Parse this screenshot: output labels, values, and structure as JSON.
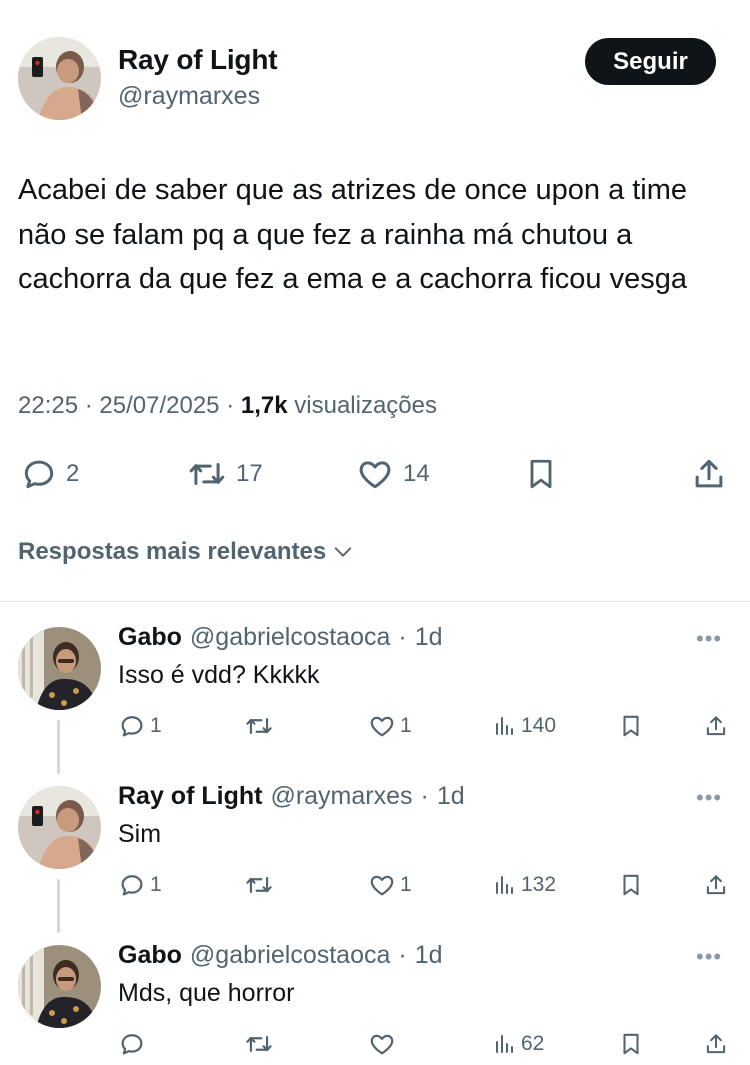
{
  "post": {
    "author_name": "Ray of Light",
    "author_handle": "@raymarxes",
    "follow_label": "Seguir",
    "text": "Acabei de saber que as atrizes de once upon a time não se falam pq a que fez a rainha má chutou a cachorra da que fez a ema e a cachorra ficou vesga",
    "time": "22:25",
    "date": "25/07/2025",
    "views_count": "1,7k",
    "views_label": "visualizações",
    "sep": "·",
    "replies": "2",
    "reposts": "17",
    "likes": "14"
  },
  "sort_label": "Respostas mais relevantes",
  "replies": [
    {
      "name": "Gabo",
      "handle": "@gabrielcostaoca",
      "age": "1d",
      "text": "Isso é vdd? Kkkkk",
      "reply_count": "1",
      "repost_count": "",
      "like_count": "1",
      "views": "140"
    },
    {
      "name": "Ray of Light",
      "handle": "@raymarxes",
      "age": "1d",
      "text": "Sim",
      "reply_count": "1",
      "repost_count": "",
      "like_count": "1",
      "views": "132"
    },
    {
      "name": "Gabo",
      "handle": "@gabrielcostaoca",
      "age": "1d",
      "text": "Mds, que horror",
      "reply_count": "",
      "repost_count": "",
      "like_count": "",
      "views": "62"
    }
  ],
  "icons": {
    "reply": "reply-icon",
    "repost": "repost-icon",
    "like": "heart-icon",
    "bookmark": "bookmark-icon",
    "share": "share-icon",
    "views": "views-icon",
    "more": "more-icon",
    "chevron": "chevron-down-icon"
  },
  "colors": {
    "text": "#0f1419",
    "secondary": "#536471",
    "button_bg": "#0f1419",
    "thread_line": "#cfd9de"
  }
}
